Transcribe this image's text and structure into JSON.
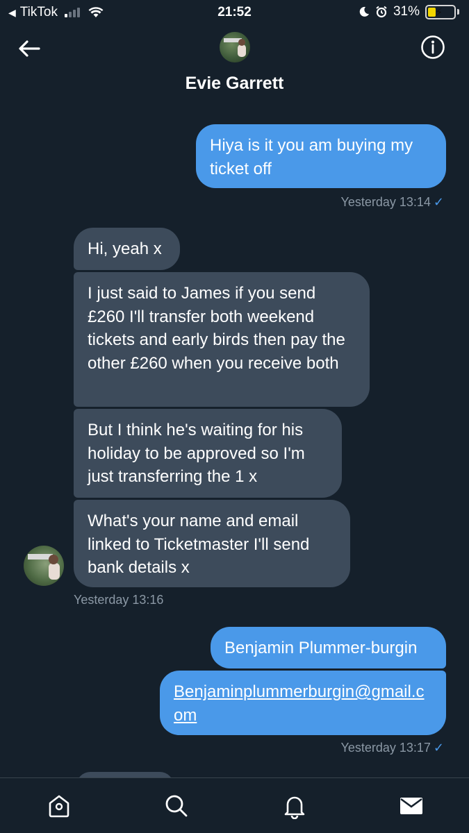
{
  "status_bar": {
    "back_app": "TikTok",
    "time": "21:52",
    "battery": "31%",
    "battery_level": 0.31
  },
  "header": {
    "contact_name": "Evie Garrett"
  },
  "messages": [
    {
      "text": "Hiya is it you am buying my ticket off"
    },
    {
      "text": "Hi, yeah x"
    },
    {
      "text": "I just said to James if you send £260 I'll transfer both weekend tickets and early birds then pay the other £260 when you receive both"
    },
    {
      "text": "But I think he's waiting for his holiday to be approved so I'm just transferring the 1 x"
    },
    {
      "text": "What's your name and email linked to Ticketmaster I'll send bank details x"
    },
    {
      "text": "Benjamin Plummer-burgin"
    },
    {
      "text": "Benjaminplummerburgin@gmail.com"
    }
  ],
  "timestamps": {
    "sent_1": "Yesterday 13:14",
    "recv_group": "Yesterday 13:16",
    "sent_2": "Yesterday 13:17"
  },
  "bottom_nav": [
    "home-icon",
    "search-icon",
    "bell-icon",
    "mail-icon"
  ],
  "colors": {
    "background": "#15202b",
    "sent_bubble": "#4a99e9",
    "received_bubble": "#3d4b5b",
    "timestamp": "#8b98a5"
  }
}
